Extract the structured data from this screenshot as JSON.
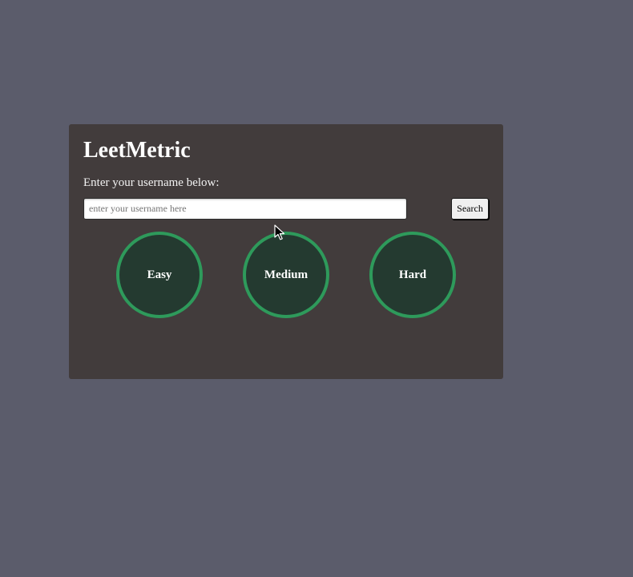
{
  "app": {
    "title": "LeetMetric"
  },
  "search": {
    "prompt_label": "Enter your username below:",
    "placeholder": "enter your username here",
    "value": "",
    "button_label": "Search"
  },
  "progress": {
    "items": [
      {
        "label": "Easy"
      },
      {
        "label": "Medium"
      },
      {
        "label": "Hard"
      }
    ],
    "ring_color": "#2e9a5b",
    "fill_color": "#243a30"
  },
  "theme": {
    "page_background": "#5b5c6b",
    "card_background": "#423c3c"
  }
}
